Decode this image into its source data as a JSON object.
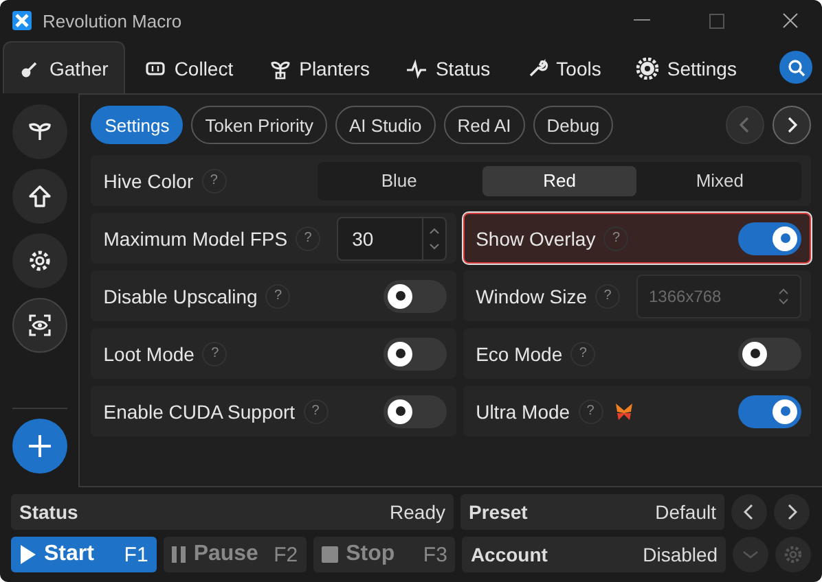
{
  "window": {
    "title": "Revolution Macro"
  },
  "tabs": [
    {
      "label": "Gather",
      "selected": true
    },
    {
      "label": "Collect",
      "selected": false
    },
    {
      "label": "Planters",
      "selected": false
    },
    {
      "label": "Status",
      "selected": false
    },
    {
      "label": "Tools",
      "selected": false
    },
    {
      "label": "Settings",
      "selected": false
    }
  ],
  "subtabs": [
    {
      "label": "Settings",
      "selected": true
    },
    {
      "label": "Token Priority",
      "selected": false
    },
    {
      "label": "AI Studio",
      "selected": false
    },
    {
      "label": "Red AI",
      "selected": false
    },
    {
      "label": "Debug",
      "selected": false
    }
  ],
  "pager": [
    {
      "disabled": true
    },
    {
      "disabled": false
    }
  ],
  "settings": [
    {
      "kind": "segmented",
      "label": "Hive Color",
      "help": "?",
      "options": [
        {
          "label": "Blue",
          "selected": false
        },
        {
          "label": "Red",
          "selected": true
        },
        {
          "label": "Mixed",
          "selected": false
        }
      ]
    },
    {
      "kind": "number",
      "label": "Maximum Model FPS",
      "help": "?",
      "value": "30",
      "highlighted": false
    },
    {
      "kind": "toggle",
      "label": "Show Overlay",
      "help": "?",
      "on": true,
      "highlighted": true
    },
    {
      "kind": "toggle",
      "label": "Disable Upscaling",
      "help": "?",
      "on": false,
      "highlighted": false
    },
    {
      "kind": "select",
      "label": "Window Size",
      "help": "?",
      "value": "1366x768",
      "disabled": true
    },
    {
      "kind": "toggle",
      "label": "Loot Mode",
      "help": "?",
      "on": false,
      "highlighted": false
    },
    {
      "kind": "toggle",
      "label": "Eco Mode",
      "help": "?",
      "on": false,
      "highlighted": false
    },
    {
      "kind": "toggle",
      "label": "Enable CUDA Support",
      "help": "?",
      "on": false,
      "highlighted": false
    },
    {
      "kind": "toggle",
      "label": "Ultra Mode",
      "help": "?",
      "on": true,
      "highlighted": false,
      "badge": true
    }
  ],
  "status": {
    "label": "Status",
    "value": "Ready"
  },
  "preset": {
    "label": "Preset",
    "value": "Default"
  },
  "account": {
    "label": "Account",
    "value": "Disabled"
  },
  "controls": [
    {
      "kind": "start",
      "label": "Start",
      "key": "F1",
      "disabled": false
    },
    {
      "kind": "pause",
      "label": "Pause",
      "key": "F2",
      "disabled": true
    },
    {
      "kind": "stop",
      "label": "Stop",
      "key": "F3",
      "disabled": true
    }
  ]
}
